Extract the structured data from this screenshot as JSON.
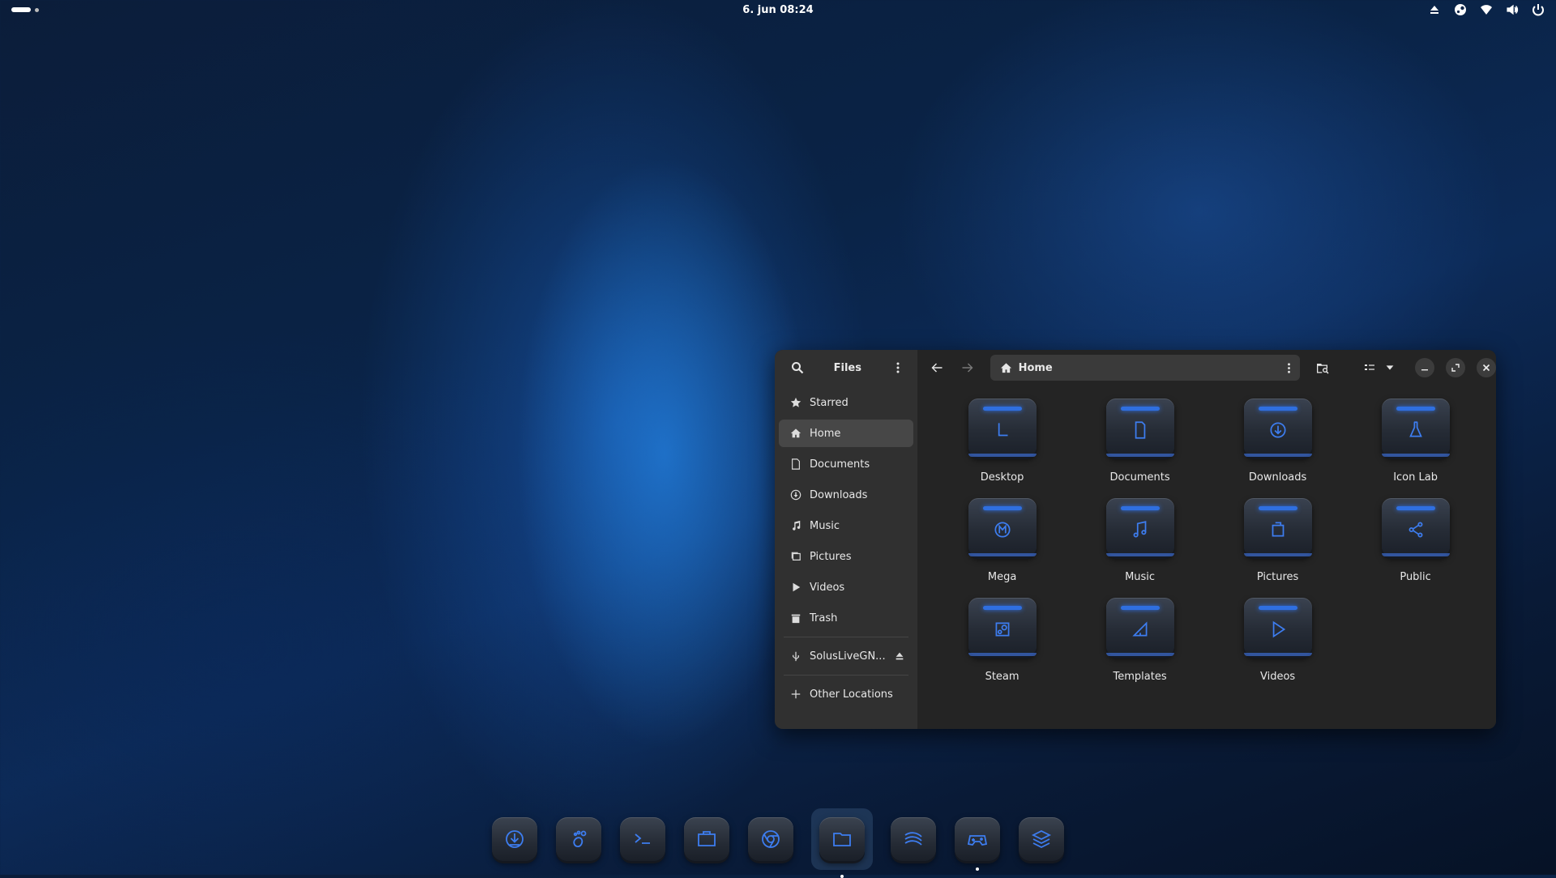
{
  "topbar": {
    "clock": "6. jun  08:24",
    "tray_icons": [
      "eject-icon",
      "steam-icon",
      "wifi-icon",
      "volume-icon",
      "power-icon"
    ]
  },
  "window": {
    "sidebar": {
      "title": "Files",
      "items": [
        {
          "label": "Starred",
          "icon": "star-icon"
        },
        {
          "label": "Home",
          "icon": "home-icon",
          "active": true
        },
        {
          "label": "Documents",
          "icon": "document-icon"
        },
        {
          "label": "Downloads",
          "icon": "download-icon"
        },
        {
          "label": "Music",
          "icon": "music-icon"
        },
        {
          "label": "Pictures",
          "icon": "pictures-icon"
        },
        {
          "label": "Videos",
          "icon": "video-icon"
        },
        {
          "label": "Trash",
          "icon": "trash-icon"
        }
      ],
      "device": {
        "label": "SolusLiveGN...",
        "icon": "usb-icon"
      },
      "other": {
        "label": "Other Locations",
        "icon": "plus-icon"
      }
    },
    "path": {
      "label": "Home"
    },
    "folders": [
      {
        "label": "Desktop",
        "icon": "desktop-icon"
      },
      {
        "label": "Documents",
        "icon": "documents-icon"
      },
      {
        "label": "Downloads",
        "icon": "downloads-icon"
      },
      {
        "label": "Icon Lab",
        "icon": "flask-icon"
      },
      {
        "label": "Mega",
        "icon": "mega-icon"
      },
      {
        "label": "Music",
        "icon": "music-icon"
      },
      {
        "label": "Pictures",
        "icon": "pictures-icon"
      },
      {
        "label": "Public",
        "icon": "share-icon"
      },
      {
        "label": "Steam",
        "icon": "steam-icon"
      },
      {
        "label": "Templates",
        "icon": "templates-icon"
      },
      {
        "label": "Videos",
        "icon": "videos-icon"
      }
    ]
  },
  "dock": [
    {
      "icon": "installer-icon"
    },
    {
      "icon": "gnome-foot-icon"
    },
    {
      "icon": "terminal-icon"
    },
    {
      "icon": "briefcase-icon"
    },
    {
      "icon": "chrome-icon"
    },
    {
      "icon": "files-icon",
      "active": true,
      "running": true
    },
    {
      "icon": "stream-icon"
    },
    {
      "icon": "gamepad-icon",
      "running": true
    },
    {
      "icon": "layers-icon"
    }
  ],
  "colors": {
    "accent": "#3d7df0",
    "window_bg": "#242424",
    "sidebar_bg": "#303030"
  }
}
